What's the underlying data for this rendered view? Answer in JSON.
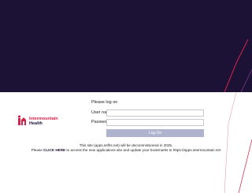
{
  "brand": {
    "name_line1": "Intermountain",
    "name_line2": "Health",
    "logo_icon": "intermountain-logo-icon",
    "primary_color": "#1c1236",
    "accent_color": "#d6224b"
  },
  "login": {
    "prompt": "Please log on",
    "username_label": "User name :",
    "password_label": "Password :",
    "username_value": "",
    "password_value": "",
    "button_label": "Log On"
  },
  "notice": {
    "line1": "This site (apps.ssfhs.net) will be decommissioned in 2025.",
    "line2_prefix": "Please ",
    "click_here": "CLICK HERE",
    "line2_suffix": " to access the new applications site and update your bookmarks to https://apps.intermountain.net"
  }
}
